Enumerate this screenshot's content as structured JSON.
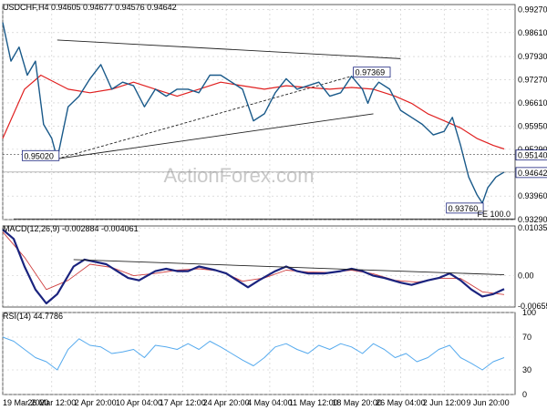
{
  "chart_data": [
    {
      "panel": "price",
      "type": "line",
      "title": "USDCHF,H4  0.94605 0.94677 0.94576 0.94642",
      "watermark": "ActionForex.com",
      "ylim": [
        0.9329,
        0.9941
      ],
      "yticks": [
        "0.99270",
        "0.98610",
        "0.97930",
        "0.97270",
        "0.96610",
        "0.95950",
        "0.95290",
        "0.94620",
        "0.93960",
        "0.93290"
      ],
      "price_label": "0.94642",
      "level_label": "0.95140",
      "annotations": [
        {
          "text": "0.95020",
          "x": "26 Mar",
          "y": 0.9502
        },
        {
          "text": "0.97369",
          "x": "20 May",
          "y": 0.97369
        },
        {
          "text": "0.93760",
          "x": "10 Jun",
          "y": 0.9376
        },
        {
          "text": "FE 100.0",
          "y": 0.9331
        }
      ],
      "close_points": [
        [
          0,
          0.989
        ],
        [
          3,
          0.978
        ],
        [
          6,
          0.982
        ],
        [
          9,
          0.974
        ],
        [
          12,
          0.978
        ],
        [
          15,
          0.96
        ],
        [
          18,
          0.956
        ],
        [
          20,
          0.9502
        ],
        [
          24,
          0.965
        ],
        [
          28,
          0.968
        ],
        [
          32,
          0.973
        ],
        [
          36,
          0.977
        ],
        [
          40,
          0.97
        ],
        [
          44,
          0.972
        ],
        [
          48,
          0.971
        ],
        [
          52,
          0.965
        ],
        [
          56,
          0.97
        ],
        [
          60,
          0.968
        ],
        [
          64,
          0.97
        ],
        [
          68,
          0.97
        ],
        [
          72,
          0.969
        ],
        [
          76,
          0.974
        ],
        [
          80,
          0.974
        ],
        [
          84,
          0.972
        ],
        [
          88,
          0.97
        ],
        [
          92,
          0.961
        ],
        [
          96,
          0.963
        ],
        [
          100,
          0.969
        ],
        [
          104,
          0.973
        ],
        [
          108,
          0.97
        ],
        [
          112,
          0.971
        ],
        [
          116,
          0.972
        ],
        [
          120,
          0.968
        ],
        [
          124,
          0.969
        ],
        [
          128,
          0.9737
        ],
        [
          132,
          0.97
        ],
        [
          134,
          0.966
        ],
        [
          136,
          0.97
        ],
        [
          138,
          0.972
        ],
        [
          142,
          0.97
        ],
        [
          146,
          0.964
        ],
        [
          150,
          0.962
        ],
        [
          154,
          0.96
        ],
        [
          158,
          0.957
        ],
        [
          162,
          0.958
        ],
        [
          165,
          0.962
        ],
        [
          168,
          0.954
        ],
        [
          171,
          0.945
        ],
        [
          174,
          0.94
        ],
        [
          176,
          0.9376
        ],
        [
          178,
          0.942
        ],
        [
          181,
          0.945
        ],
        [
          184,
          0.9464
        ]
      ],
      "ma_points": [
        [
          0,
          0.956
        ],
        [
          8,
          0.97
        ],
        [
          14,
          0.974
        ],
        [
          24,
          0.97
        ],
        [
          32,
          0.969
        ],
        [
          40,
          0.97
        ],
        [
          48,
          0.972
        ],
        [
          56,
          0.97
        ],
        [
          64,
          0.968
        ],
        [
          72,
          0.97
        ],
        [
          80,
          0.972
        ],
        [
          88,
          0.971
        ],
        [
          96,
          0.97
        ],
        [
          104,
          0.971
        ],
        [
          112,
          0.9705
        ],
        [
          120,
          0.97
        ],
        [
          128,
          0.9705
        ],
        [
          136,
          0.97
        ],
        [
          144,
          0.968
        ],
        [
          150,
          0.966
        ],
        [
          156,
          0.963
        ],
        [
          162,
          0.961
        ],
        [
          168,
          0.959
        ],
        [
          174,
          0.956
        ],
        [
          180,
          0.954
        ],
        [
          184,
          0.953
        ]
      ],
      "trendlines": [
        {
          "from": [
            20,
            0.984
          ],
          "to": [
            146,
            0.9787
          ]
        },
        {
          "from": [
            20,
            0.9502
          ],
          "to": [
            136,
            0.963
          ]
        },
        {
          "from": [
            20,
            0.9502
          ],
          "to": [
            128,
            0.9737
          ]
        }
      ]
    },
    {
      "panel": "macd",
      "type": "line",
      "title": "MACD(12,26,9) -0.002884 -0.004061",
      "ylim": [
        -0.0068,
        0.0108
      ],
      "yticks": [
        "0.010358",
        "0.00",
        "-0.006553"
      ],
      "zero_label": "0.00",
      "macd_points": [
        [
          0,
          0.01
        ],
        [
          4,
          0.008
        ],
        [
          8,
          0.002
        ],
        [
          12,
          -0.003
        ],
        [
          16,
          -0.006
        ],
        [
          20,
          -0.004
        ],
        [
          26,
          0.002
        ],
        [
          30,
          0.0035
        ],
        [
          34,
          0.003
        ],
        [
          38,
          0.0025
        ],
        [
          42,
          0.001
        ],
        [
          46,
          -0.0005
        ],
        [
          50,
          -0.001
        ],
        [
          56,
          0.001
        ],
        [
          60,
          0.0015
        ],
        [
          64,
          0.001
        ],
        [
          68,
          0.001
        ],
        [
          72,
          0.002
        ],
        [
          78,
          0.0012
        ],
        [
          82,
          0.0005
        ],
        [
          86,
          -0.001
        ],
        [
          90,
          -0.0025
        ],
        [
          94,
          -0.001
        ],
        [
          100,
          0.001
        ],
        [
          104,
          0.002
        ],
        [
          108,
          0.001
        ],
        [
          112,
          0.0005
        ],
        [
          118,
          0.0005
        ],
        [
          124,
          0.001
        ],
        [
          128,
          0.0015
        ],
        [
          132,
          0.001
        ],
        [
          136,
          0.0
        ],
        [
          140,
          -0.0005
        ],
        [
          146,
          -0.0015
        ],
        [
          150,
          -0.002
        ],
        [
          156,
          -0.001
        ],
        [
          160,
          -0.0005
        ],
        [
          164,
          0.0005
        ],
        [
          168,
          -0.001
        ],
        [
          172,
          -0.003
        ],
        [
          176,
          -0.0045
        ],
        [
          180,
          -0.004
        ],
        [
          184,
          -0.0029
        ]
      ],
      "signal_points": [
        [
          0,
          0.0095
        ],
        [
          8,
          0.004
        ],
        [
          16,
          -0.003
        ],
        [
          24,
          -0.001
        ],
        [
          32,
          0.0025
        ],
        [
          40,
          0.0018
        ],
        [
          48,
          0.0
        ],
        [
          56,
          0.0005
        ],
        [
          64,
          0.0012
        ],
        [
          72,
          0.0015
        ],
        [
          80,
          0.001
        ],
        [
          88,
          -0.0012
        ],
        [
          96,
          -0.0005
        ],
        [
          104,
          0.0012
        ],
        [
          112,
          0.0008
        ],
        [
          120,
          0.0007
        ],
        [
          128,
          0.0012
        ],
        [
          136,
          0.0004
        ],
        [
          144,
          -0.001
        ],
        [
          152,
          -0.0014
        ],
        [
          160,
          -0.0006
        ],
        [
          168,
          -0.0006
        ],
        [
          176,
          -0.0035
        ],
        [
          184,
          -0.0041
        ]
      ],
      "trendline": {
        "from": [
          26,
          0.0035
        ],
        "to": [
          184,
          0.0002
        ]
      }
    },
    {
      "panel": "rsi",
      "type": "line",
      "title": "RSI(14) 44.7786",
      "ylim": [
        0,
        100
      ],
      "yticks": [
        "100",
        "70",
        "30",
        "0"
      ],
      "rsi_points": [
        [
          0,
          70
        ],
        [
          4,
          65
        ],
        [
          8,
          55
        ],
        [
          12,
          45
        ],
        [
          16,
          40
        ],
        [
          20,
          30
        ],
        [
          24,
          55
        ],
        [
          28,
          68
        ],
        [
          32,
          60
        ],
        [
          36,
          58
        ],
        [
          40,
          50
        ],
        [
          44,
          52
        ],
        [
          48,
          55
        ],
        [
          52,
          45
        ],
        [
          56,
          60
        ],
        [
          60,
          58
        ],
        [
          64,
          55
        ],
        [
          68,
          62
        ],
        [
          72,
          55
        ],
        [
          76,
          65
        ],
        [
          80,
          58
        ],
        [
          84,
          50
        ],
        [
          88,
          42
        ],
        [
          92,
          35
        ],
        [
          96,
          45
        ],
        [
          100,
          58
        ],
        [
          104,
          62
        ],
        [
          108,
          55
        ],
        [
          112,
          50
        ],
        [
          116,
          60
        ],
        [
          120,
          55
        ],
        [
          124,
          62
        ],
        [
          128,
          58
        ],
        [
          132,
          50
        ],
        [
          136,
          62
        ],
        [
          140,
          55
        ],
        [
          144,
          45
        ],
        [
          148,
          50
        ],
        [
          152,
          40
        ],
        [
          156,
          45
        ],
        [
          160,
          55
        ],
        [
          164,
          60
        ],
        [
          168,
          45
        ],
        [
          172,
          38
        ],
        [
          176,
          30
        ],
        [
          180,
          40
        ],
        [
          184,
          45
        ]
      ]
    }
  ],
  "x_axis": {
    "n_bars": 185,
    "ticks": [
      {
        "label": "19 Mar 2020",
        "bar": 0
      },
      {
        "label": "26 Mar 12:00",
        "bar": 18
      },
      {
        "label": "2 Apr 20:00",
        "bar": 34
      },
      {
        "label": "10 Apr 04:00",
        "bar": 50
      },
      {
        "label": "17 Apr 12:00",
        "bar": 66
      },
      {
        "label": "24 Apr 20:00",
        "bar": 82
      },
      {
        "label": "4 May 04:00",
        "bar": 98
      },
      {
        "label": "11 May 12:00",
        "bar": 114
      },
      {
        "label": "18 May 20:00",
        "bar": 130
      },
      {
        "label": "26 May 04:00",
        "bar": 146
      },
      {
        "label": "2 Jun 12:00",
        "bar": 162
      },
      {
        "label": "9 Jun 20:00",
        "bar": 178
      }
    ]
  },
  "colors": {
    "price_line": "#1a5a8a",
    "ma_line": "#e02020",
    "macd_line": "#1a237e",
    "signal_line": "#d04040",
    "rsi_line": "#55aaee",
    "grid": "#c8c8c8",
    "label_bg": "#ffffff",
    "label_border": "#1a237e"
  }
}
